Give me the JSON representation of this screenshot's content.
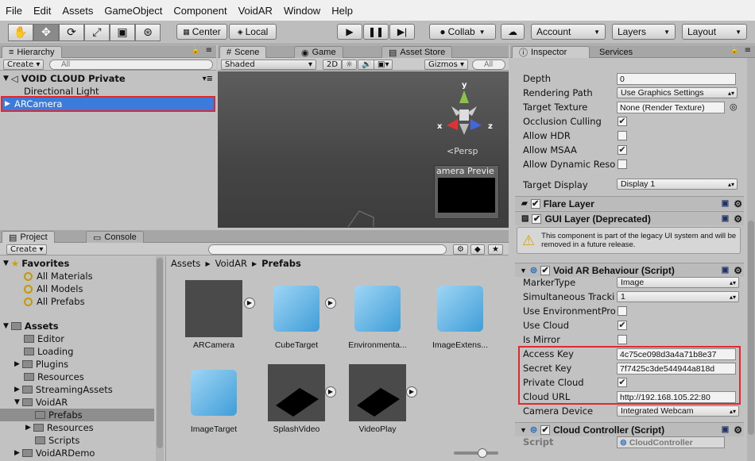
{
  "menu": [
    "File",
    "Edit",
    "Assets",
    "GameObject",
    "Component",
    "VoidAR",
    "Window",
    "Help"
  ],
  "toolbar": {
    "tools": [
      "hand",
      "move",
      "rotate",
      "scale",
      "rect",
      "transform"
    ],
    "center": "Center",
    "local": "Local",
    "collab": "Collab",
    "account": "Account",
    "layers": "Layers",
    "layout": "Layout"
  },
  "hierarchy": {
    "tab": "Hierarchy",
    "create": "Create",
    "search_placeholder": "All",
    "scene": "VOID CLOUD Private",
    "items": [
      "Directional Light",
      "ARCamera"
    ]
  },
  "scene": {
    "tabs": [
      "Scene",
      "Game",
      "Asset Store"
    ],
    "shading": "Shaded",
    "mode2d": "2D",
    "gizmos": "Gizmos",
    "search_placeholder": "All",
    "persp": "Persp",
    "axis": [
      "y",
      "x",
      "z"
    ],
    "preview": "amera Previe"
  },
  "project": {
    "tabs": [
      "Project",
      "Console"
    ],
    "create": "Create",
    "favorites": "Favorites",
    "fav_items": [
      "All Materials",
      "All Models",
      "All Prefabs"
    ],
    "assets": "Assets",
    "folders": [
      "Editor",
      "Loading",
      "Plugins",
      "Resources",
      "StreamingAssets",
      "VoidAR",
      "Prefabs",
      "Resources",
      "Scripts",
      "VoidARDemo"
    ],
    "breadcrumb": [
      "Assets",
      "VoidAR",
      "Prefabs"
    ],
    "asset_items": [
      "ARCamera",
      "CubeTarget",
      "Environmenta...",
      "ImageExtens...",
      "ImageTarget",
      "SplashVideo",
      "VideoPlay"
    ]
  },
  "inspector": {
    "tabs": [
      "Inspector",
      "Services"
    ],
    "camera": [
      {
        "label": "Depth",
        "value": "0"
      },
      {
        "label": "Rendering Path",
        "value": "Use Graphics Settings"
      },
      {
        "label": "Target Texture",
        "value": "None (Render Texture)"
      },
      {
        "label": "Occlusion Culling",
        "checked": true
      },
      {
        "label": "Allow HDR",
        "checked": false
      },
      {
        "label": "Allow MSAA",
        "checked": true
      },
      {
        "label": "Allow Dynamic Reso",
        "checked": false
      },
      {
        "label": "Target Display",
        "value": "Display 1"
      }
    ],
    "flare": "Flare Layer",
    "gui": "GUI Layer (Deprecated)",
    "warning": "This component is part of the legacy UI system and will be removed in a future release.",
    "void_title": "Void AR Behaviour (Script)",
    "void": [
      {
        "label": "MarkerType",
        "value": "Image"
      },
      {
        "label": "Simultaneous Tracki",
        "value": "1"
      },
      {
        "label": "Use EnvironmentPro",
        "checked": false
      },
      {
        "label": "Use Cloud",
        "checked": true
      },
      {
        "label": "Is Mirror",
        "checked": false
      },
      {
        "label": "Access Key",
        "value": "4c75ce098d3a4a71b8e37"
      },
      {
        "label": "Secret Key",
        "value": "7f7425c3de544944a818d"
      },
      {
        "label": "Private Cloud",
        "checked": true
      },
      {
        "label": "Cloud URL",
        "value": "http://192.168.105.22:80"
      },
      {
        "label": "Camera Device",
        "value": "Integrated Webcam"
      }
    ],
    "cloud_title": "Cloud Controller (Script)",
    "script_label": "Script",
    "script_value": "CloudController"
  }
}
